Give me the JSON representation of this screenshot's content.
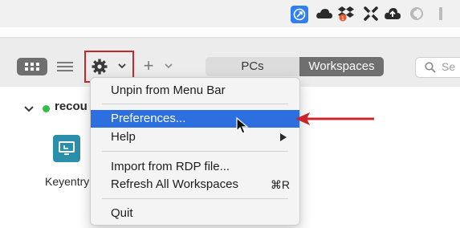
{
  "toolbar": {
    "segments": {
      "pcs": "PCs",
      "workspaces": "Workspaces"
    },
    "search_placeholder": "Se",
    "add_symbol": "+"
  },
  "content": {
    "group_name": "recou",
    "workspace_label": "Keyentry"
  },
  "menu": {
    "items": [
      {
        "label": "Unpin from Menu Bar"
      },
      {
        "label": "Preferences...",
        "highlighted": true
      },
      {
        "label": "Help",
        "submenu": true
      },
      {
        "label": "Import from RDP file..."
      },
      {
        "label": "Refresh All Workspaces",
        "shortcut": "⌘R"
      },
      {
        "label": "Quit"
      }
    ]
  },
  "colors": {
    "highlight": "#2d6fde",
    "annotation_red": "#c8262b",
    "selected_segment": "#6f6f6f",
    "status_green": "#2fbf4a"
  },
  "icons": {
    "menubar": [
      "remote-desktop-icon",
      "cloud-icon",
      "dropbox-icon",
      "crossed-tools-icon",
      "cloud-upload-icon",
      "moon-icon",
      "overflow-icon"
    ]
  }
}
